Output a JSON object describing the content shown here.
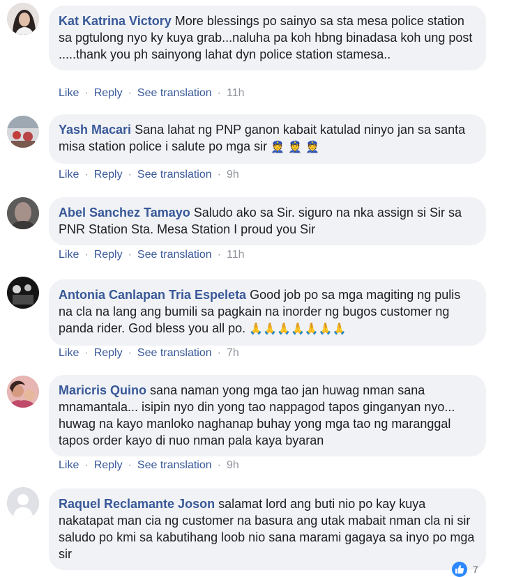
{
  "actions": {
    "like": "Like",
    "reply": "Reply",
    "see_translation": "See translation"
  },
  "comments": [
    {
      "author": "Kat Katrina Victory",
      "text": "More blessings po sainyo sa sta mesa police station sa pgtulong nyo ky kuya grab...naluha pa koh hbng binadasa koh ung post .....thank you ph sainyong lahat dyn police station stamesa..",
      "time": "11h"
    },
    {
      "author": "Yash Macari",
      "text": "Sana lahat ng PNP ganon kabait katulad ninyo jan sa santa misa station police i salute po mga sir",
      "time": "9h"
    },
    {
      "author": "Abel Sanchez Tamayo",
      "text": "Saludo ako sa Sir. siguro na nka assign si Sir sa PNR Station Sta. Mesa Station I proud you Sir",
      "time": "11h"
    },
    {
      "author": "Antonia Canlapan Tria Espeleta",
      "text": "Good job po sa mga magiting ng pulis na cla na lang ang bumili sa pagkain na inorder ng bugos customer ng panda rider. God bless you all po.",
      "time": "7h"
    },
    {
      "author": "Maricris Quino",
      "text": "sana naman yong mga tao jan huwag nman sana mnamantala... isipin nyo din yong tao nappagod tapos ginganyan nyo... huwag na kayo manloko naghanap buhay yong mga tao ng maranggal tapos order kayo di nuo nman pala kaya byaran",
      "time": "9h"
    },
    {
      "author": "Raquel Reclamante Joson",
      "text": "salamat lord ang buti nio po kay kuya nakatapat man cia ng customer na basura ang utak mabait nman cla ni sir saludo po kmi sa kabutihang loob nio sana marami gagaya sa inyo po mga sir",
      "reaction_count": "7"
    }
  ]
}
